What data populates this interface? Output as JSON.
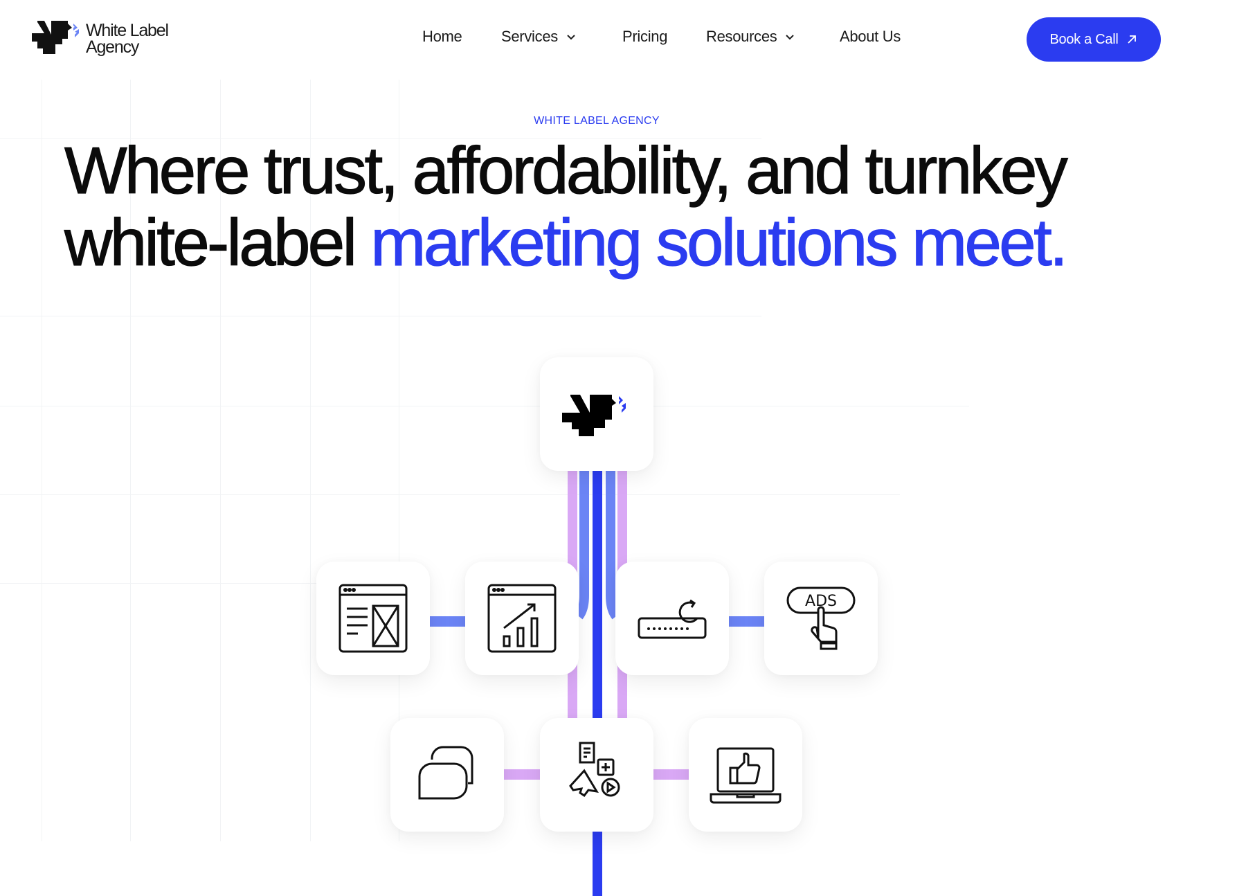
{
  "header": {
    "logo": {
      "line1": "White Label",
      "line2": "Agency"
    },
    "nav": [
      {
        "label": "Home",
        "dropdown": false
      },
      {
        "label": "Services",
        "dropdown": true
      },
      {
        "label": "Pricing",
        "dropdown": false
      },
      {
        "label": "Resources",
        "dropdown": true
      },
      {
        "label": "About Us",
        "dropdown": false
      }
    ],
    "cta": {
      "label": "Book a Call",
      "icon": "arrow-up-right-icon"
    }
  },
  "hero": {
    "eyebrow": "WHITE LABEL AGENCY",
    "headline_line1": "Where trust, affordability, and turnkey",
    "headline_line2_plain": "white-label",
    "headline_line2_accent": "marketing solutions meet."
  },
  "diagram": {
    "center_icon": "brand-logo-icon",
    "row1": [
      "web-design-icon",
      "analytics-chart-icon",
      "password-reset-icon",
      "ads-click-icon"
    ],
    "row2": [
      "chat-bubbles-icon",
      "content-marketing-icon",
      "laptop-thumbs-up-icon"
    ],
    "ads_text": "ADS"
  },
  "colors": {
    "accent": "#2b3cf0",
    "light_blue": "#6b84f5",
    "lilac": "#d9a8f5",
    "text": "#0b0b0b"
  }
}
